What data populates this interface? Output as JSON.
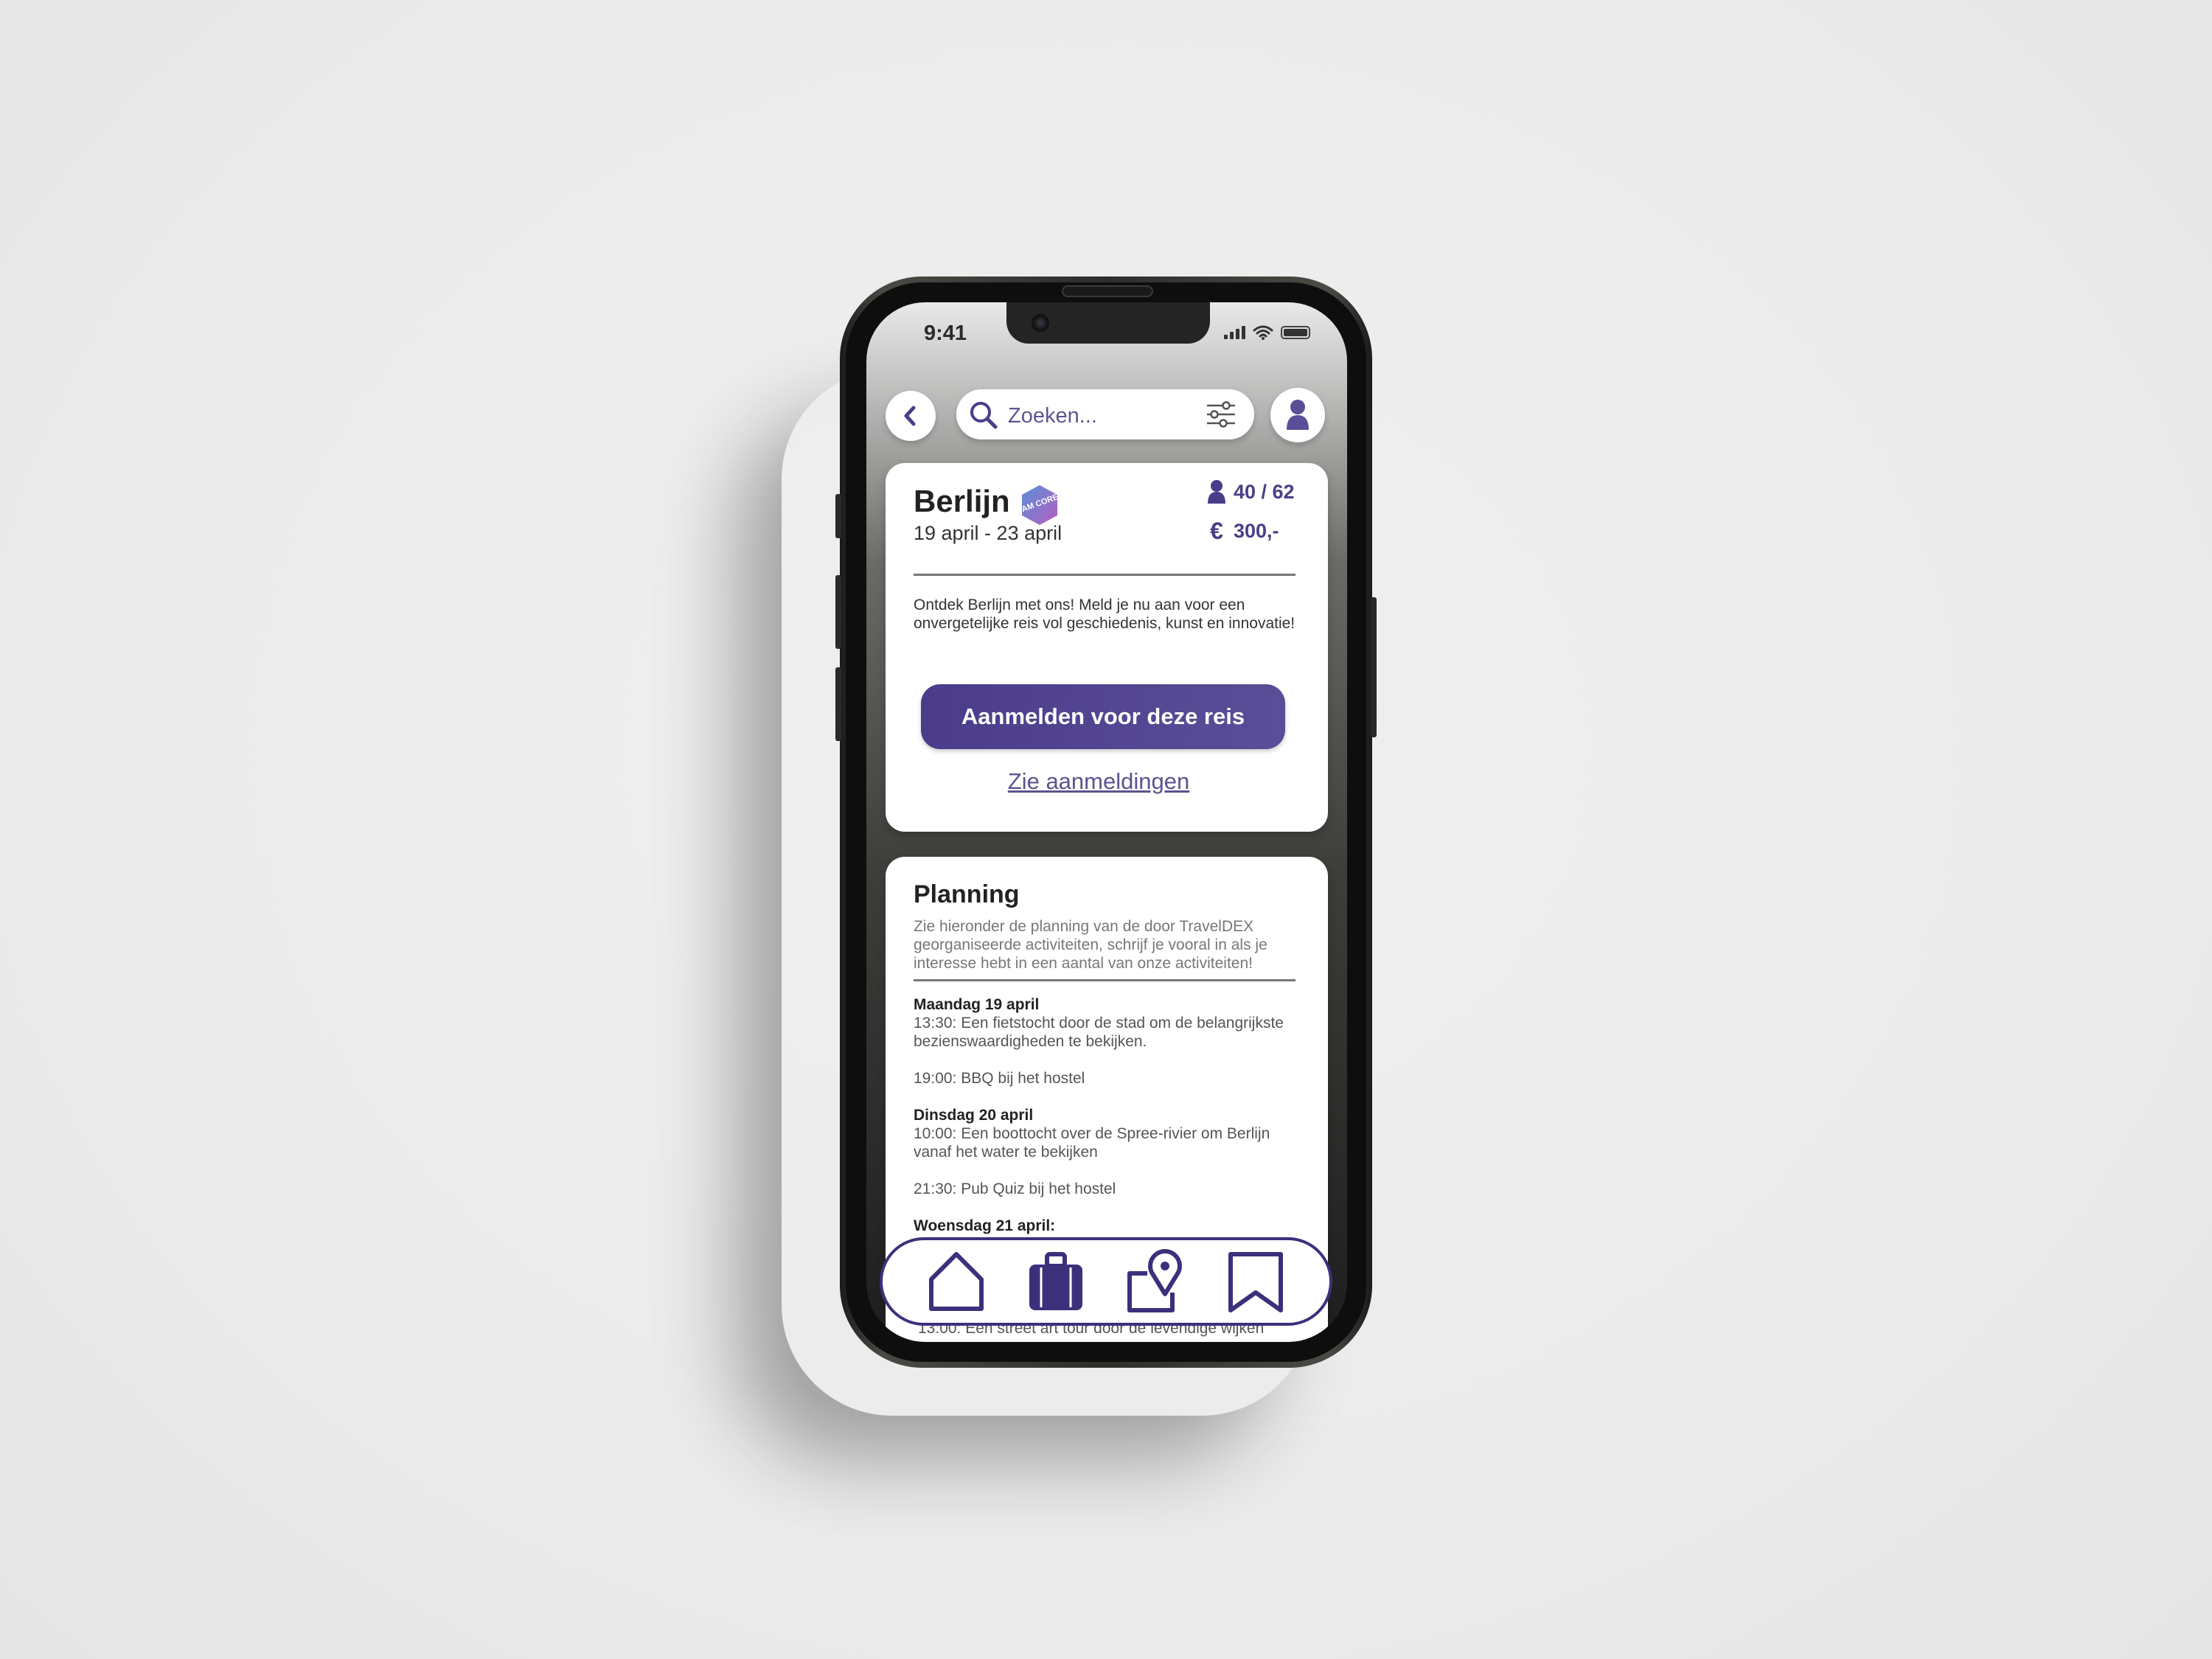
{
  "status_bar": {
    "time": "9:41"
  },
  "search": {
    "placeholder": "Zoeken..."
  },
  "trip": {
    "title": "Berlijn",
    "badge_text": "IAM CORE",
    "dates": "19 april - 23 april",
    "participants": "40 / 62",
    "price": "300,-",
    "price_symbol": "€",
    "description": "Ontdek Berlijn met ons! Meld je nu aan voor een onvergetelijke reis vol geschiedenis, kunst en innovatie!",
    "signup_button": "Aanmelden voor deze reis",
    "view_signups_link": "Zie aanmeldingen"
  },
  "planning": {
    "title": "Planning",
    "intro": "Zie hieronder de planning van de door TravelDEX georganiseerde activiteiten, schrijf je vooral in als je interesse hebt in een aantal van onze activiteiten!",
    "days": [
      {
        "day": "Maandag 19 april",
        "items": [
          "13:30: Een fietstocht door de stad om de belangrijkste bezienswaardigheden te bekijken.",
          "19:00: BBQ bij het hostel"
        ]
      },
      {
        "day": "Dinsdag 20 april",
        "items": [
          "10:00: Een boottocht over de Spree-rivier om Berlijn vanaf het water te bekijken",
          "21:30: Pub Quiz bij het hostel"
        ]
      },
      {
        "day": "Woensdag 21 april:",
        "items": []
      }
    ],
    "cut_off_line": "13:00: Een street art tour door de levendige wijken"
  },
  "tabbar": {
    "items": [
      {
        "icon": "home-icon"
      },
      {
        "icon": "suitcase-icon"
      },
      {
        "icon": "map-pin-icon"
      },
      {
        "icon": "bookmark-icon"
      }
    ]
  },
  "colors": {
    "accent": "#4b3c8a",
    "accent_light": "#5d528f",
    "badge_gradient": [
      "#5a8fd9",
      "#b45fbf"
    ]
  }
}
